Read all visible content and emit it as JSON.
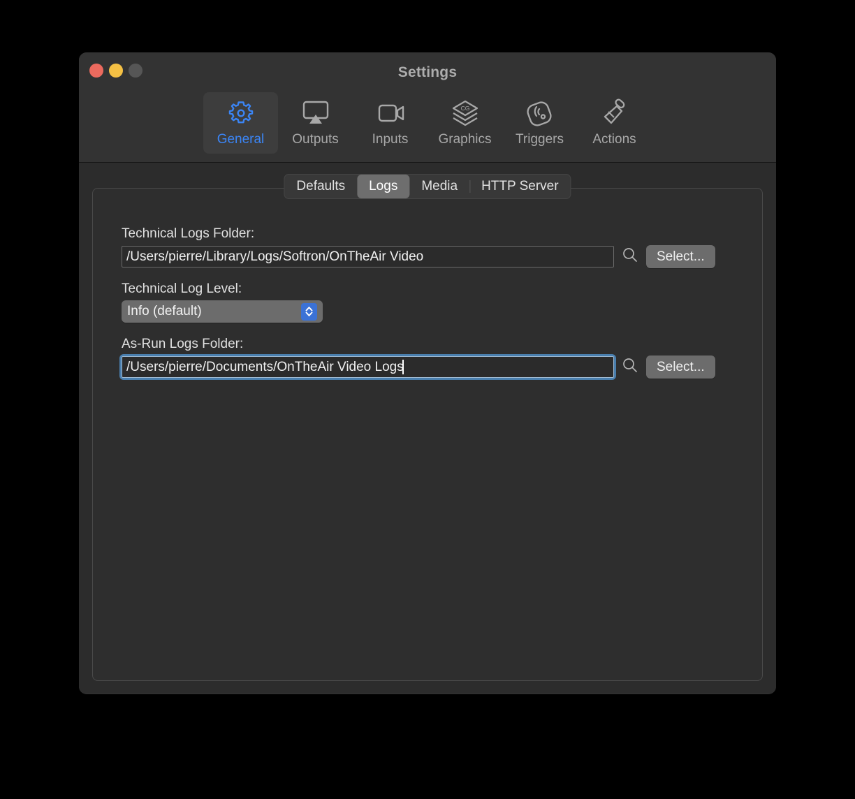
{
  "window": {
    "title": "Settings",
    "traffic_lights": [
      {
        "name": "close",
        "color": "#ec6a5e"
      },
      {
        "name": "minimize",
        "color": "#f4c044"
      },
      {
        "name": "zoom",
        "color": "#565656"
      }
    ]
  },
  "toolbar": {
    "items": [
      {
        "label": "General",
        "icon": "gear-icon",
        "selected": true
      },
      {
        "label": "Outputs",
        "icon": "airplay-display-icon",
        "selected": false
      },
      {
        "label": "Inputs",
        "icon": "video-camera-icon",
        "selected": false
      },
      {
        "label": "Graphics",
        "icon": "cg-layers-icon",
        "selected": false
      },
      {
        "label": "Triggers",
        "icon": "remote-signal-icon",
        "selected": false
      },
      {
        "label": "Actions",
        "icon": "paint-roller-icon",
        "selected": false
      }
    ],
    "accent_color": "#3b85f5"
  },
  "tabs": [
    {
      "label": "Defaults",
      "selected": false
    },
    {
      "label": "Logs",
      "selected": true
    },
    {
      "label": "Media",
      "selected": false
    },
    {
      "label": "HTTP Server",
      "selected": false
    }
  ],
  "form": {
    "technical_logs": {
      "label": "Technical Logs Folder:",
      "value": "/Users/pierre/Library/Logs/Softron/OnTheAir Video",
      "search_icon": "magnifying-glass-icon",
      "button_label": "Select..."
    },
    "technical_log_level": {
      "label": "Technical Log Level:",
      "value": "Info (default)",
      "chevron_icon": "chevron-up-down-icon"
    },
    "as_run_logs": {
      "label": "As-Run Logs Folder:",
      "value": "/Users/pierre/Documents/OnTheAir Video Logs",
      "focused": true,
      "search_icon": "magnifying-glass-icon",
      "button_label": "Select..."
    }
  }
}
